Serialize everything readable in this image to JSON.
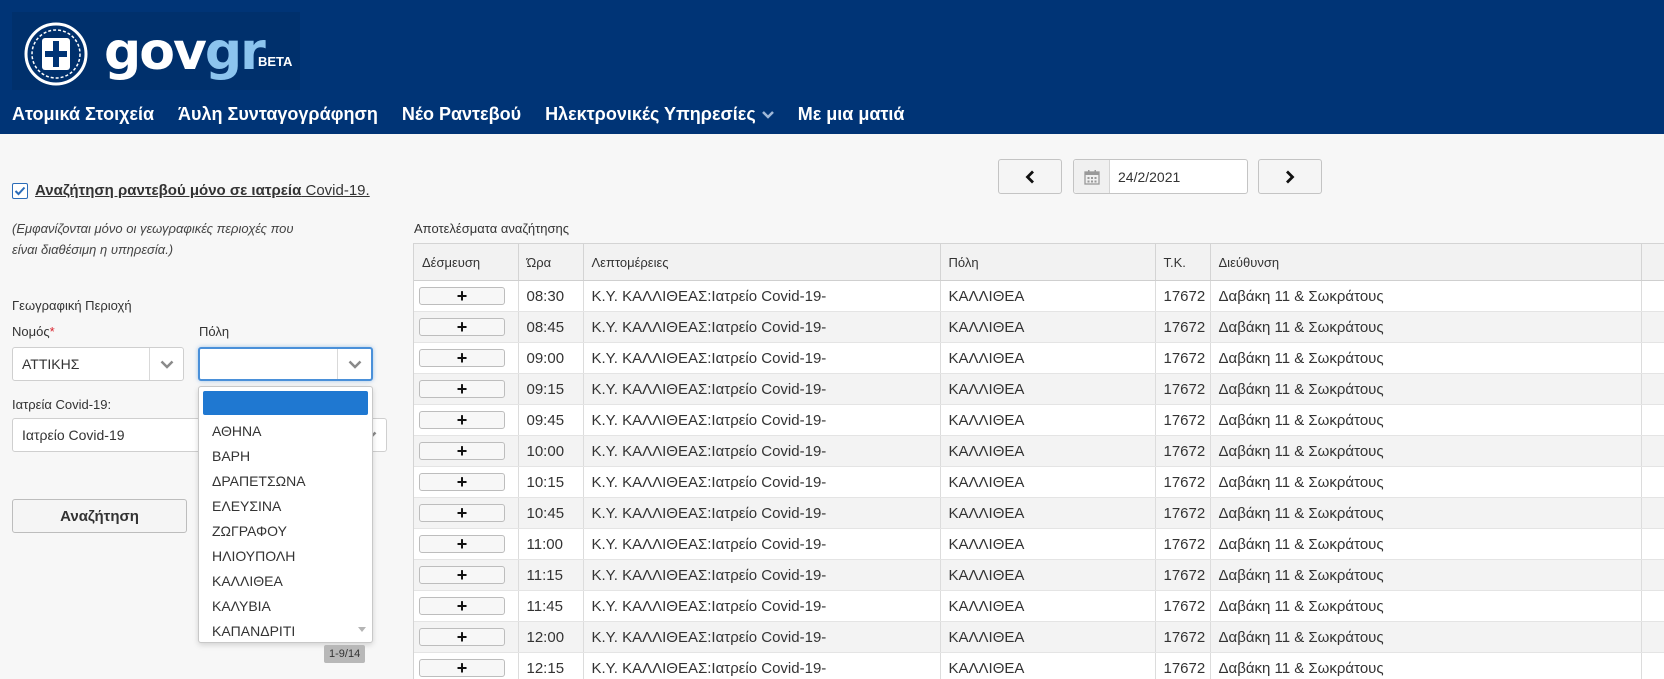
{
  "header": {
    "logo_gov": "gov",
    "logo_gr": "gr",
    "logo_beta": "BETA",
    "nav": [
      {
        "label": "Ατομικά Στοιχεία"
      },
      {
        "label": "Άυλη Συνταγογράφηση"
      },
      {
        "label": "Νέο Ραντεβού"
      },
      {
        "label": "Ηλεκτρονικές Υπηρεσίες",
        "has_dropdown": true
      },
      {
        "label": "Με μια ματιά"
      }
    ],
    "colors": {
      "background": "#003476",
      "logo_accent": "#8cc4ee"
    }
  },
  "filters": {
    "covid_only_checked": true,
    "covid_label_bold": "Αναζήτηση ραντεβού μόνο σε ιατρεία",
    "covid_label_rest": " Covid-19.",
    "note": "(Εμφανίζονται μόνο οι γεωγραφικές περιοχές που είναι διαθέσιμη η υπηρεσία.)",
    "region_label": "Γεωγραφική Περιοχή",
    "nomos_label": "Νομός",
    "nomos_required": "*",
    "nomos_value": "ΑΤΤΙΚΗΣ",
    "poli_label": "Πόλη",
    "poli_value": "",
    "iatreia_label": "Ιατρεία Covid-19:",
    "iatreia_value": "Ιατρείο Covid-19",
    "search_button": "Αναζήτηση"
  },
  "poli_dropdown": {
    "options": [
      "ΑΘΗΝΑ",
      "ΒΑΡΗ",
      "ΔΡΑΠΕΤΣΩΝΑ",
      "ΕΛΕΥΣΙΝΑ",
      "ΖΩΓΡΑΦΟΥ",
      "ΗΛΙΟΥΠΟΛΗ",
      "ΚΑΛΛΙΘΕΑ",
      "ΚΑΛΥΒΙΑ",
      "ΚΑΠΑΝΔΡΙΤΙ"
    ],
    "pager": "1-9/14"
  },
  "date_nav": {
    "date": "24/2/2021"
  },
  "results": {
    "label": "Αποτελέσματα αναζήτησης",
    "columns": [
      "Δέσμευση",
      "Ώρα",
      "Λεπτομέρειες",
      "Πόλη",
      "Τ.Κ.",
      "Διεύθυνση"
    ],
    "book_symbol": "+",
    "rows": [
      {
        "time": "08:30",
        "details": "Κ.Υ. ΚΑΛΛΙΘΕΑΣ:Ιατρείο Covid-19-",
        "city": "ΚΑΛΛΙΘΕΑ",
        "tk": "17672",
        "address": "Δαβάκη 11 & Σωκράτους"
      },
      {
        "time": "08:45",
        "details": "Κ.Υ. ΚΑΛΛΙΘΕΑΣ:Ιατρείο Covid-19-",
        "city": "ΚΑΛΛΙΘΕΑ",
        "tk": "17672",
        "address": "Δαβάκη 11 & Σωκράτους"
      },
      {
        "time": "09:00",
        "details": "Κ.Υ. ΚΑΛΛΙΘΕΑΣ:Ιατρείο Covid-19-",
        "city": "ΚΑΛΛΙΘΕΑ",
        "tk": "17672",
        "address": "Δαβάκη 11 & Σωκράτους"
      },
      {
        "time": "09:15",
        "details": "Κ.Υ. ΚΑΛΛΙΘΕΑΣ:Ιατρείο Covid-19-",
        "city": "ΚΑΛΛΙΘΕΑ",
        "tk": "17672",
        "address": "Δαβάκη 11 & Σωκράτους"
      },
      {
        "time": "09:45",
        "details": "Κ.Υ. ΚΑΛΛΙΘΕΑΣ:Ιατρείο Covid-19-",
        "city": "ΚΑΛΛΙΘΕΑ",
        "tk": "17672",
        "address": "Δαβάκη 11 & Σωκράτους"
      },
      {
        "time": "10:00",
        "details": "Κ.Υ. ΚΑΛΛΙΘΕΑΣ:Ιατρείο Covid-19-",
        "city": "ΚΑΛΛΙΘΕΑ",
        "tk": "17672",
        "address": "Δαβάκη 11 & Σωκράτους"
      },
      {
        "time": "10:15",
        "details": "Κ.Υ. ΚΑΛΛΙΘΕΑΣ:Ιατρείο Covid-19-",
        "city": "ΚΑΛΛΙΘΕΑ",
        "tk": "17672",
        "address": "Δαβάκη 11 & Σωκράτους"
      },
      {
        "time": "10:45",
        "details": "Κ.Υ. ΚΑΛΛΙΘΕΑΣ:Ιατρείο Covid-19-",
        "city": "ΚΑΛΛΙΘΕΑ",
        "tk": "17672",
        "address": "Δαβάκη 11 & Σωκράτους"
      },
      {
        "time": "11:00",
        "details": "Κ.Υ. ΚΑΛΛΙΘΕΑΣ:Ιατρείο Covid-19-",
        "city": "ΚΑΛΛΙΘΕΑ",
        "tk": "17672",
        "address": "Δαβάκη 11 & Σωκράτους"
      },
      {
        "time": "11:15",
        "details": "Κ.Υ. ΚΑΛΛΙΘΕΑΣ:Ιατρείο Covid-19-",
        "city": "ΚΑΛΛΙΘΕΑ",
        "tk": "17672",
        "address": "Δαβάκη 11 & Σωκράτους"
      },
      {
        "time": "11:45",
        "details": "Κ.Υ. ΚΑΛΛΙΘΕΑΣ:Ιατρείο Covid-19-",
        "city": "ΚΑΛΛΙΘΕΑ",
        "tk": "17672",
        "address": "Δαβάκη 11 & Σωκράτους"
      },
      {
        "time": "12:00",
        "details": "Κ.Υ. ΚΑΛΛΙΘΕΑΣ:Ιατρείο Covid-19-",
        "city": "ΚΑΛΛΙΘΕΑ",
        "tk": "17672",
        "address": "Δαβάκη 11 & Σωκράτους"
      },
      {
        "time": "12:15",
        "details": "Κ.Υ. ΚΑΛΛΙΘΕΑΣ:Ιατρείο Covid-19-",
        "city": "ΚΑΛΛΙΘΕΑ",
        "tk": "17672",
        "address": "Δαβάκη 11 & Σωκράτους"
      }
    ]
  },
  "icons": [
    "greek-emblem-icon",
    "chevron-down-icon",
    "checkmark-icon",
    "chevron-left-icon",
    "chevron-right-icon",
    "calendar-icon",
    "plus-icon",
    "scroll-down-arrow-icon"
  ]
}
